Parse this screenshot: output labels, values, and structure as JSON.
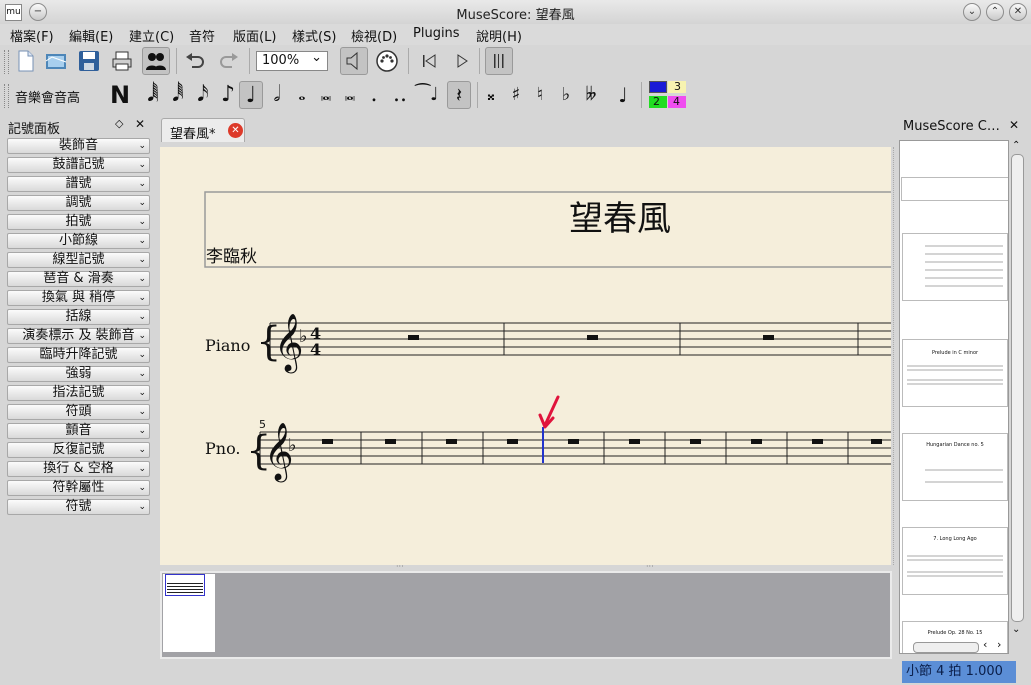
{
  "window": {
    "title": "MuseScore: 望春風",
    "logo": "mu"
  },
  "menu": [
    "檔案(F)",
    "編輯(E)",
    "建立(C)",
    "音符",
    "版面(L)",
    "樣式(S)",
    "檢視(D)",
    "Plugins",
    "說明(H)"
  ],
  "toolbar": {
    "zoom": "100%",
    "zoom_arrow": "⌄"
  },
  "note_input": {
    "label": "音樂會音高",
    "n_label": "N",
    "voice_numbers": [
      "3",
      "2",
      "4"
    ],
    "voice_colors": {
      "v1": "#1a1ad6",
      "v2": "#22dd22",
      "v3": "#f7f3b0",
      "v4": "#f04df0"
    }
  },
  "palette": {
    "title": "記號面板",
    "items": [
      "裝飾音",
      "鼓譜記號",
      "譜號",
      "調號",
      "拍號",
      "小節線",
      "線型記號",
      "琶音 & 滑奏",
      "換氣 與 稍停",
      "括線",
      "演奏標示 及 裝飾音",
      "臨時升降記號",
      "強弱",
      "指法記號",
      "符頭",
      "顫音",
      "反復記號",
      "換行 & 空格",
      "符幹屬性",
      "符號"
    ]
  },
  "tab": {
    "label": "望春風*"
  },
  "score": {
    "title": "望春風",
    "composer": "李臨秋",
    "staff1_name": "Piano",
    "staff2_name": "Pno.",
    "measure_number": "5",
    "accent": "#e0143c",
    "cursor": "#2233cc"
  },
  "right_panel": {
    "title": "MuseScore C…",
    "thumbs": [
      {
        "title": "",
        "subtitle": ""
      },
      {
        "title": "Prelude in C minor",
        "subtitle": ""
      },
      {
        "title": "Hungarian Dance no. 5",
        "subtitle": ""
      },
      {
        "title": "7. Long Long Ago",
        "subtitle": ""
      },
      {
        "title": "Prelude Op. 28 No. 15",
        "subtitle": ""
      }
    ]
  },
  "status": {
    "text": "小節  4 拍  1.000"
  }
}
